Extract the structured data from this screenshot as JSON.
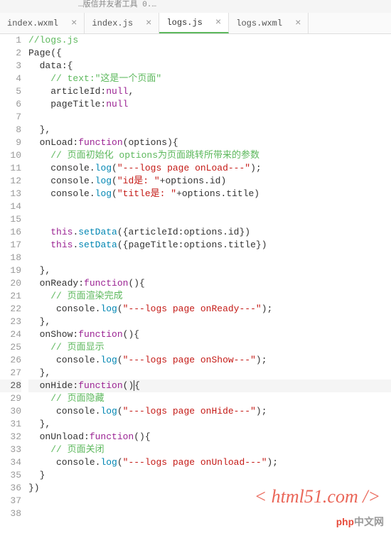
{
  "titlebar": "…版信并友者工具 0.…",
  "tabs": [
    {
      "label": "index.wxml",
      "active": false
    },
    {
      "label": "index.js",
      "active": false
    },
    {
      "label": "logs.js",
      "active": true
    },
    {
      "label": "logs.wxml",
      "active": false
    }
  ],
  "code_lines": [
    {
      "n": 1,
      "tokens": [
        {
          "t": "//logs.js",
          "c": "c-comment"
        }
      ]
    },
    {
      "n": 2,
      "tokens": [
        {
          "t": "Page",
          "c": "c-id"
        },
        {
          "t": "({",
          "c": "c-brace"
        }
      ]
    },
    {
      "n": 3,
      "tokens": [
        {
          "t": "  data",
          "c": "c-id"
        },
        {
          "t": ":{",
          "c": "c-brace"
        }
      ]
    },
    {
      "n": 4,
      "tokens": [
        {
          "t": "    ",
          "c": ""
        },
        {
          "t": "// text:\"这是一个页面\"",
          "c": "c-comment"
        }
      ]
    },
    {
      "n": 5,
      "tokens": [
        {
          "t": "    articleId",
          "c": "c-id"
        },
        {
          "t": ":",
          "c": "c-brace"
        },
        {
          "t": "null",
          "c": "c-keyword"
        },
        {
          "t": ",",
          "c": "c-brace"
        }
      ]
    },
    {
      "n": 6,
      "tokens": [
        {
          "t": "    pageTitle",
          "c": "c-id"
        },
        {
          "t": ":",
          "c": "c-brace"
        },
        {
          "t": "null",
          "c": "c-keyword"
        }
      ]
    },
    {
      "n": 7,
      "tokens": []
    },
    {
      "n": 8,
      "tokens": [
        {
          "t": "  },",
          "c": "c-brace"
        }
      ]
    },
    {
      "n": 9,
      "tokens": [
        {
          "t": "  onLoad",
          "c": "c-id"
        },
        {
          "t": ":",
          "c": "c-brace"
        },
        {
          "t": "function",
          "c": "c-keyword"
        },
        {
          "t": "(",
          "c": "c-brace"
        },
        {
          "t": "options",
          "c": "c-id"
        },
        {
          "t": "){",
          "c": "c-brace"
        }
      ]
    },
    {
      "n": 10,
      "tokens": [
        {
          "t": "    ",
          "c": ""
        },
        {
          "t": "// 页面初始化 options为页面跳转所带来的参数",
          "c": "c-comment"
        }
      ]
    },
    {
      "n": 11,
      "tokens": [
        {
          "t": "    console",
          "c": "c-id"
        },
        {
          "t": ".",
          "c": "c-brace"
        },
        {
          "t": "log",
          "c": "c-func"
        },
        {
          "t": "(",
          "c": "c-brace"
        },
        {
          "t": "\"---logs page onLoad---\"",
          "c": "c-string"
        },
        {
          "t": ");",
          "c": "c-brace"
        }
      ]
    },
    {
      "n": 12,
      "tokens": [
        {
          "t": "    console",
          "c": "c-id"
        },
        {
          "t": ".",
          "c": "c-brace"
        },
        {
          "t": "log",
          "c": "c-func"
        },
        {
          "t": "(",
          "c": "c-brace"
        },
        {
          "t": "\"id是: \"",
          "c": "c-string"
        },
        {
          "t": "+options.id)",
          "c": "c-id"
        }
      ]
    },
    {
      "n": 13,
      "tokens": [
        {
          "t": "    console",
          "c": "c-id"
        },
        {
          "t": ".",
          "c": "c-brace"
        },
        {
          "t": "log",
          "c": "c-func"
        },
        {
          "t": "(",
          "c": "c-brace"
        },
        {
          "t": "\"title是: \"",
          "c": "c-string"
        },
        {
          "t": "+options.title)",
          "c": "c-id"
        }
      ]
    },
    {
      "n": 14,
      "tokens": []
    },
    {
      "n": 15,
      "tokens": []
    },
    {
      "n": 16,
      "tokens": [
        {
          "t": "    ",
          "c": ""
        },
        {
          "t": "this",
          "c": "c-keyword"
        },
        {
          "t": ".",
          "c": "c-brace"
        },
        {
          "t": "setData",
          "c": "c-func"
        },
        {
          "t": "({articleId:options.id})",
          "c": "c-id"
        }
      ]
    },
    {
      "n": 17,
      "tokens": [
        {
          "t": "    ",
          "c": ""
        },
        {
          "t": "this",
          "c": "c-keyword"
        },
        {
          "t": ".",
          "c": "c-brace"
        },
        {
          "t": "setData",
          "c": "c-func"
        },
        {
          "t": "({pageTitle:options.title})",
          "c": "c-id"
        }
      ]
    },
    {
      "n": 18,
      "tokens": []
    },
    {
      "n": 19,
      "tokens": [
        {
          "t": "  },",
          "c": "c-brace"
        }
      ]
    },
    {
      "n": 20,
      "tokens": [
        {
          "t": "  onReady",
          "c": "c-id"
        },
        {
          "t": ":",
          "c": "c-brace"
        },
        {
          "t": "function",
          "c": "c-keyword"
        },
        {
          "t": "(){",
          "c": "c-brace"
        }
      ]
    },
    {
      "n": 21,
      "tokens": [
        {
          "t": "    ",
          "c": ""
        },
        {
          "t": "// 页面渲染完成",
          "c": "c-comment"
        }
      ]
    },
    {
      "n": 22,
      "tokens": [
        {
          "t": "     console",
          "c": "c-id"
        },
        {
          "t": ".",
          "c": "c-brace"
        },
        {
          "t": "log",
          "c": "c-func"
        },
        {
          "t": "(",
          "c": "c-brace"
        },
        {
          "t": "\"---logs page onReady---\"",
          "c": "c-string"
        },
        {
          "t": ");",
          "c": "c-brace"
        }
      ]
    },
    {
      "n": 23,
      "tokens": [
        {
          "t": "  },",
          "c": "c-brace"
        }
      ]
    },
    {
      "n": 24,
      "tokens": [
        {
          "t": "  onShow",
          "c": "c-id"
        },
        {
          "t": ":",
          "c": "c-brace"
        },
        {
          "t": "function",
          "c": "c-keyword"
        },
        {
          "t": "(){",
          "c": "c-brace"
        }
      ]
    },
    {
      "n": 25,
      "tokens": [
        {
          "t": "    ",
          "c": ""
        },
        {
          "t": "// 页面显示",
          "c": "c-comment"
        }
      ]
    },
    {
      "n": 26,
      "tokens": [
        {
          "t": "     console",
          "c": "c-id"
        },
        {
          "t": ".",
          "c": "c-brace"
        },
        {
          "t": "log",
          "c": "c-func"
        },
        {
          "t": "(",
          "c": "c-brace"
        },
        {
          "t": "\"---logs page onShow---\"",
          "c": "c-string"
        },
        {
          "t": ");",
          "c": "c-brace"
        }
      ]
    },
    {
      "n": 27,
      "tokens": [
        {
          "t": "  },",
          "c": "c-brace"
        }
      ]
    },
    {
      "n": 28,
      "cursor": true,
      "tokens": [
        {
          "t": "  onHide",
          "c": "c-id"
        },
        {
          "t": ":",
          "c": "c-brace"
        },
        {
          "t": "function",
          "c": "c-keyword"
        },
        {
          "t": "()",
          "c": "c-brace"
        },
        {
          "t": "CURSOR",
          "c": "cursor"
        },
        {
          "t": "{",
          "c": "c-brace"
        }
      ]
    },
    {
      "n": 29,
      "tokens": [
        {
          "t": "    ",
          "c": ""
        },
        {
          "t": "// 页面隐藏",
          "c": "c-comment"
        }
      ]
    },
    {
      "n": 30,
      "tokens": [
        {
          "t": "     console",
          "c": "c-id"
        },
        {
          "t": ".",
          "c": "c-brace"
        },
        {
          "t": "log",
          "c": "c-func"
        },
        {
          "t": "(",
          "c": "c-brace"
        },
        {
          "t": "\"---logs page onHide---\"",
          "c": "c-string"
        },
        {
          "t": ");",
          "c": "c-brace"
        }
      ]
    },
    {
      "n": 31,
      "tokens": [
        {
          "t": "  },",
          "c": "c-brace"
        }
      ]
    },
    {
      "n": 32,
      "tokens": [
        {
          "t": "  onUnload",
          "c": "c-id"
        },
        {
          "t": ":",
          "c": "c-brace"
        },
        {
          "t": "function",
          "c": "c-keyword"
        },
        {
          "t": "(){",
          "c": "c-brace"
        }
      ]
    },
    {
      "n": 33,
      "tokens": [
        {
          "t": "    ",
          "c": ""
        },
        {
          "t": "// 页面关闭",
          "c": "c-comment"
        }
      ]
    },
    {
      "n": 34,
      "tokens": [
        {
          "t": "     console",
          "c": "c-id"
        },
        {
          "t": ".",
          "c": "c-brace"
        },
        {
          "t": "log",
          "c": "c-func"
        },
        {
          "t": "(",
          "c": "c-brace"
        },
        {
          "t": "\"---logs page onUnload---\"",
          "c": "c-string"
        },
        {
          "t": ");",
          "c": "c-brace"
        }
      ]
    },
    {
      "n": 35,
      "tokens": [
        {
          "t": "  }",
          "c": "c-brace"
        }
      ]
    },
    {
      "n": 36,
      "tokens": [
        {
          "t": "})",
          "c": "c-brace"
        }
      ]
    },
    {
      "n": 37,
      "tokens": []
    },
    {
      "n": 38,
      "tokens": []
    }
  ],
  "watermark1": "< html51.com />",
  "watermark2_php": "php",
  "watermark2_rest": "中文网"
}
